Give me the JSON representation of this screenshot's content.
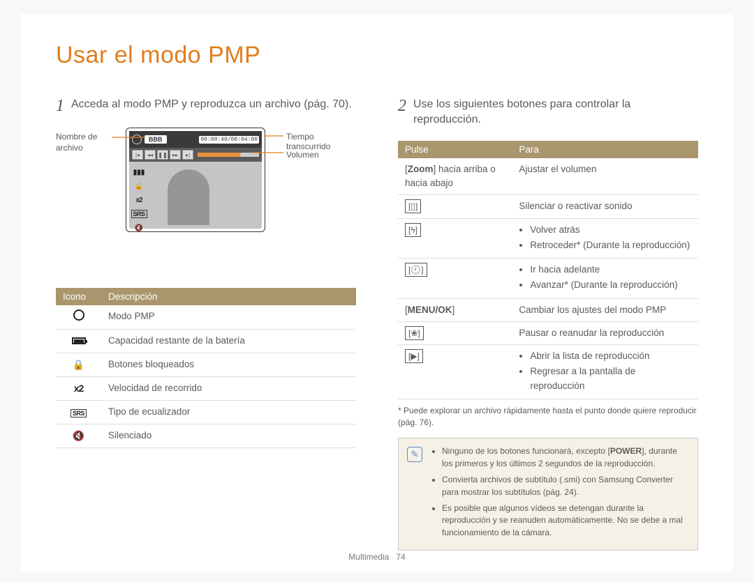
{
  "title": "Usar el modo PMP",
  "steps": {
    "1": "Acceda al modo PMP y reproduzca un archivo (pág. 70).",
    "2": "Use los siguientes botones para controlar la reproducción."
  },
  "diagram": {
    "filename_label": "Nombre de archivo",
    "filename_value": "BBB",
    "time_label": "Tiempo transcurrido",
    "time_value": "00:00:40/00:04:00",
    "volume_label": "Volumen"
  },
  "iconTable": {
    "headers": {
      "icon": "Icono",
      "desc": "Descripción"
    },
    "rows": [
      {
        "icon": "film-reel-icon",
        "desc": "Modo PMP"
      },
      {
        "icon": "battery-icon",
        "desc": "Capacidad restante de la batería"
      },
      {
        "icon": "lock-icon",
        "desc": "Botones bloqueados"
      },
      {
        "icon": "x2-icon",
        "desc": "Velocidad de recorrido"
      },
      {
        "icon": "srs-icon",
        "desc": "Tipo de ecualizador"
      },
      {
        "icon": "mute-icon",
        "desc": "Silenciado"
      }
    ]
  },
  "controlTable": {
    "headers": {
      "press": "Pulse",
      "to": "Para"
    },
    "rows": [
      {
        "press_html": "[<b>Zoom</b>] hacia arriba o hacia abajo",
        "to": "Ajustar el volumen"
      },
      {
        "press_icon": "display-icon",
        "press_glyph": "[▯]",
        "to": "Silenciar o reactivar sonido"
      },
      {
        "press_icon": "flash-icon",
        "press_glyph": "[ϟ]",
        "to_list": [
          "Volver atrás",
          "Retroceder* (Durante la reproducción)"
        ]
      },
      {
        "press_icon": "timer-icon",
        "press_glyph": "[🕘]",
        "to_list": [
          "Ir hacia adelante",
          "Avanzar* (Durante la reproducción)"
        ]
      },
      {
        "press_html": "[<b>MENU/OK</b>]",
        "to": "Cambiar los ajustes del modo PMP"
      },
      {
        "press_icon": "macro-icon",
        "press_glyph": "[❀]",
        "to": "Pausar o reanudar la reproducción"
      },
      {
        "press_icon": "play-icon",
        "press_glyph": "[▶]",
        "to_list": [
          "Abrir la lista de reproducción",
          "Regresar a la pantalla de reproducción"
        ]
      }
    ]
  },
  "footnote": "* Puede explorar un archivo rápidamente hasta el punto donde quiere reproducir (pág. 76).",
  "infobox": {
    "items": [
      "Ninguno de los botones funcionará, excepto [<b>POWER</b>], durante los primeros y los últimos 2 segundos de la reproducción.",
      "Convierta archivos de subtítulo (.smi) con Samsung Converter para mostrar los subtítulos (pág. 24).",
      "Es posible que algunos vídeos se detengan durante la reproducción y se reanuden automáticamente. No se debe a mal funcionamiento de la cámara."
    ]
  },
  "footer": {
    "section": "Multimedia",
    "page": "74"
  }
}
